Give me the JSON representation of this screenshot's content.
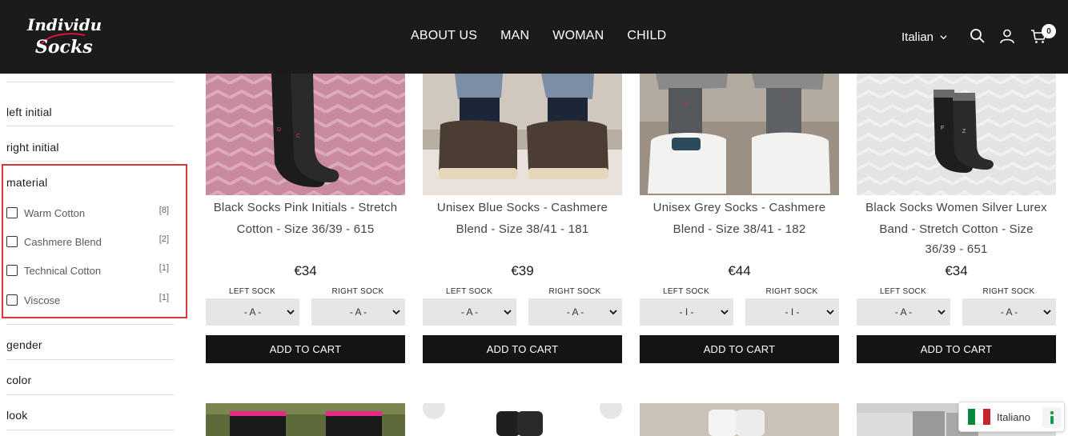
{
  "header": {
    "logo_alt": "Individual Socks",
    "nav": [
      "ABOUT US",
      "MAN",
      "WOMAN",
      "CHILD"
    ],
    "language": "Italian",
    "cart_count": "0",
    "icons": [
      "search-icon",
      "account-icon",
      "cart-icon"
    ]
  },
  "sidebar": {
    "left_initial": "left initial",
    "right_initial": "right initial",
    "material": "material",
    "materials": [
      {
        "label": "Warm Cotton",
        "count": "[8]"
      },
      {
        "label": "Cashmere Blend",
        "count": "[2]"
      },
      {
        "label": "Technical Cotton",
        "count": "[1]"
      },
      {
        "label": "Viscose",
        "count": "[1]"
      }
    ],
    "gender": "gender",
    "color": "color",
    "look": "look"
  },
  "products": [
    {
      "title_line1": "Black Socks Pink Initials - Stretch",
      "title_line2": "Cotton - Size 36/39 - 615",
      "title_line3": "",
      "price": "€34",
      "left_label": "LEFT SOCK",
      "right_label": "RIGHT SOCK",
      "left_value": "- A -",
      "right_value": "- A -",
      "cta": "ADD TO CART"
    },
    {
      "title_line1": "Unisex Blue Socks - Cashmere",
      "title_line2": "Blend - Size 38/41 - 181",
      "title_line3": "",
      "price": "€39",
      "left_label": "LEFT SOCK",
      "right_label": "RIGHT SOCK",
      "left_value": "- A -",
      "right_value": "- A -",
      "cta": "ADD TO CART"
    },
    {
      "title_line1": "Unisex Grey Socks - Cashmere",
      "title_line2": "Blend - Size 38/41 - 182",
      "title_line3": "",
      "price": "€44",
      "left_label": "LEFT SOCK",
      "right_label": "RIGHT SOCK",
      "left_value": "- I -",
      "right_value": "- I -",
      "cta": "ADD TO CART"
    },
    {
      "title_line1": "Black Socks Women Silver Lurex",
      "title_line2": "Band - Stretch Cotton - Size",
      "title_line3": "36/39 - 651",
      "price": "€34",
      "left_label": "LEFT SOCK",
      "right_label": "RIGHT SOCK",
      "left_value": "- A -",
      "right_value": "- A -",
      "cta": "ADD TO CART"
    }
  ],
  "language_widget": {
    "label": "Italiano"
  },
  "colors": {
    "header_bg": "#1b1b1b",
    "highlight": "#d93838",
    "button_bg": "#141414"
  }
}
